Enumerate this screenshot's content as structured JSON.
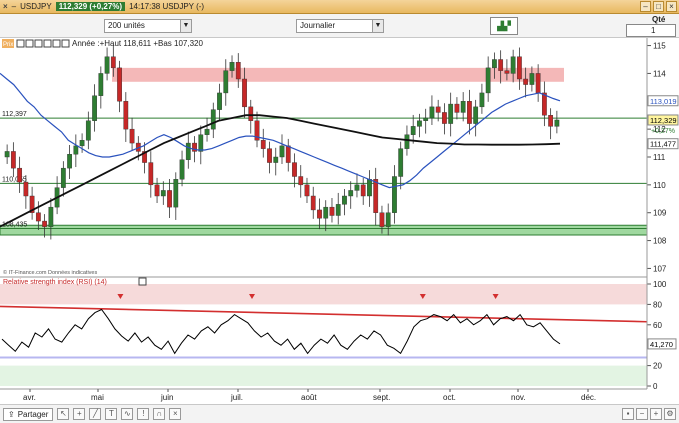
{
  "window": {
    "symbol": "USDJPY",
    "quote": "112,329 (+0,27%)",
    "time_label": "14:17:38 USDJPY (-)",
    "qty_label": "Qté",
    "qty_value": "1"
  },
  "toolbar": {
    "units": "200 unités",
    "period": "Journalier"
  },
  "statusbar": {
    "share_label": "Partager"
  },
  "price_panel": {
    "legend_tag": "Prix",
    "legend": "Année :+Haut 118,611 +Bas 107,320",
    "source": "© IT-Finance.com  Données indicatives",
    "y_ticks": [
      "115",
      "114",
      "113",
      "112",
      "111",
      "110",
      "109",
      "108",
      "107"
    ],
    "left_labels": [
      "112,397",
      "110,055",
      "108,435"
    ],
    "right_boxes": {
      "ma_fast": "113,019",
      "last": "112,329",
      "change": "+0,27%",
      "ma_slow": "111,477"
    }
  },
  "rsi_panel": {
    "title": "Relative strength index (RSI) (14)",
    "y_ticks": [
      "100",
      "80",
      "60",
      "40",
      "20",
      "0"
    ],
    "last": "41,270"
  },
  "x_ticks": [
    "avr.",
    "mai",
    "juin",
    "juil.",
    "août",
    "sept.",
    "oct.",
    "nov.",
    "déc."
  ],
  "colors": {
    "up": "#2e7d32",
    "down": "#c62828",
    "ma_slow": "#111111",
    "ma_fast": "#2a52be",
    "resistance_zone": "#f4b8b8",
    "support_zone": "#9fd89f",
    "trendline": "#d32f2f",
    "rsi_line": "#000000",
    "rsi_overbought": "#f6dada",
    "rsi_oversold": "#e3f4e3",
    "rsi_level": "#b7b7f0"
  },
  "chart_data": [
    {
      "type": "candlestick",
      "title": "USDJPY",
      "ylim": [
        106.8,
        115.2
      ],
      "months": [
        "avr.",
        "mai",
        "juin",
        "juil.",
        "août",
        "sept.",
        "oct.",
        "nov.",
        "déc."
      ],
      "year_high": 118.611,
      "year_low": 107.32,
      "horizontal_levels": [
        112.397,
        110.055,
        108.435
      ],
      "resistance_zone": [
        113.7,
        114.2
      ],
      "support_zone": [
        108.2,
        108.55
      ],
      "ma_fast_last": 113.019,
      "ma_slow_last": 111.477,
      "last": 112.329,
      "closes": [
        111.2,
        110.6,
        110.1,
        109.6,
        109.0,
        108.7,
        108.5,
        109.2,
        109.9,
        110.6,
        111.1,
        111.4,
        111.6,
        112.3,
        113.2,
        114.0,
        114.6,
        114.2,
        113.0,
        112.0,
        111.5,
        111.2,
        110.8,
        110.0,
        109.6,
        109.8,
        109.2,
        110.2,
        110.9,
        111.5,
        111.2,
        111.8,
        112.0,
        112.7,
        113.3,
        114.1,
        114.4,
        113.8,
        112.8,
        112.3,
        111.6,
        111.3,
        110.8,
        111.0,
        111.4,
        110.8,
        110.3,
        110.0,
        109.6,
        109.1,
        108.8,
        109.2,
        108.9,
        109.3,
        109.6,
        109.8,
        110.0,
        109.6,
        110.2,
        109.0,
        108.5,
        109.0,
        110.3,
        111.3,
        111.8,
        112.1,
        112.3,
        112.4,
        112.8,
        112.6,
        112.2,
        112.9,
        112.6,
        113.0,
        112.2,
        112.8,
        113.3,
        114.2,
        114.5,
        114.1,
        114.0,
        114.6,
        113.8,
        113.6,
        114.0,
        113.3,
        112.5,
        112.1,
        112.329
      ],
      "ma_fast": [
        114.0,
        113.8,
        113.6,
        113.3,
        113.0,
        112.8,
        112.5,
        112.3,
        112.1,
        111.9,
        111.6,
        111.45,
        111.3,
        111.15,
        111.05,
        111.0,
        111.0,
        111.05,
        111.1,
        111.2,
        111.3,
        111.4,
        111.55,
        111.7,
        111.8,
        111.7,
        111.55,
        111.4,
        111.3,
        111.25,
        111.25,
        111.3,
        111.4,
        111.5,
        111.6,
        111.7,
        111.75,
        111.75,
        111.7,
        111.65,
        111.6,
        111.5,
        111.4,
        111.3,
        111.2,
        111.1,
        111.0,
        110.9,
        110.8,
        110.7,
        110.6,
        110.5,
        110.4,
        110.3,
        110.2,
        110.1,
        110.0,
        109.9,
        109.95,
        110.0,
        110.15,
        110.35,
        110.6,
        110.8,
        111.0,
        111.2,
        111.4,
        111.6,
        111.8,
        112.0,
        112.2,
        112.4,
        112.6,
        112.75,
        112.9,
        113.0,
        113.1,
        113.2,
        113.25,
        113.3,
        113.2,
        113.1,
        113.019
      ],
      "ma_slow": [
        108.5,
        108.75,
        109.0,
        109.25,
        109.5,
        109.75,
        110.0,
        110.25,
        110.5,
        110.75,
        111.0,
        111.25,
        111.5,
        111.7,
        111.9,
        112.1,
        112.3,
        112.4,
        112.5,
        112.5,
        112.45,
        112.4,
        112.3,
        112.2,
        112.1,
        112.0,
        111.9,
        111.8,
        111.7,
        111.65,
        111.6,
        111.55,
        111.5,
        111.48,
        111.45,
        111.45,
        111.44,
        111.44,
        111.44,
        111.45,
        111.46,
        111.477
      ]
    },
    {
      "type": "line",
      "title": "Relative strength index (RSI) (14)",
      "ylim": [
        0,
        100
      ],
      "overbought": 80,
      "oversold": 20,
      "last": 41.27,
      "trendline": [
        78,
        63
      ],
      "values": [
        46,
        40,
        34,
        43,
        38,
        52,
        48,
        56,
        46,
        43,
        52,
        60,
        56,
        66,
        72,
        75,
        66,
        56,
        49,
        44,
        52,
        43,
        48,
        40,
        36,
        44,
        32,
        42,
        50,
        46,
        54,
        58,
        52,
        60,
        64,
        70,
        66,
        62,
        54,
        48,
        52,
        44,
        40,
        46,
        36,
        42,
        32,
        40,
        46,
        42,
        50,
        40,
        36,
        44,
        50,
        46,
        54,
        50,
        40,
        37,
        32,
        44,
        58,
        64,
        66,
        70,
        68,
        64,
        70,
        62,
        66,
        60,
        64,
        70,
        60,
        66,
        68,
        64,
        70,
        60,
        58,
        62,
        54,
        46,
        41.27
      ]
    }
  ]
}
